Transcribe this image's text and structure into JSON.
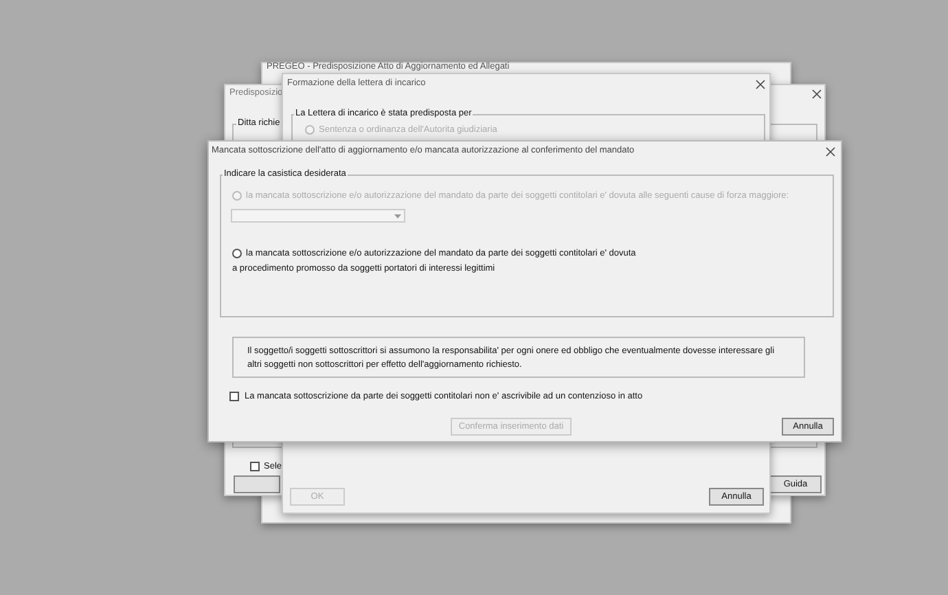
{
  "back_window": {
    "title": "PREGEO - Predisposizione Atto di Aggiornamento ed Allegati"
  },
  "middle_window": {
    "title": "Predisposizio",
    "group_title": "Ditta richie",
    "checkbox": {
      "label": "Sele",
      "checked": false
    },
    "help_button": "Guida"
  },
  "letter_window": {
    "title": "Formazione della lettera di incarico",
    "group_title": "La Lettera di incarico è stata predisposta per",
    "radio": {
      "label": "Sentenza o ordinanza dell'Autorita giudiziaria",
      "selected": false,
      "disabled": true
    },
    "ok_button": {
      "label": "OK",
      "disabled": true
    },
    "cancel_button": "Annulla"
  },
  "dialog": {
    "title": "Mancata sottoscrizione dell'atto di aggiornamento e/o mancata autorizzazione al conferimento del mandato",
    "group_title": "Indicare la casistica desiderata",
    "options": [
      {
        "kind": "radio_dropdown",
        "label": "la mancata sottoscrizione e/o autorizzazione del mandato da parte dei soggetti contitolari e' dovuta alle seguenti cause di forza maggiore:",
        "selected": false,
        "disabled": true
      },
      {
        "kind": "radio",
        "label": "la mancata sottoscrizione e/o autorizzazione del mandato da parte dei soggetti contitolari e' dovuta",
        "label_line_2": "a procedimento promosso da soggetti portatori di interessi legittimi",
        "selected": false,
        "disabled": false
      }
    ],
    "notice": "Il soggetto/i soggetti sottoscrittori si assumono la responsabilita' per ogni onere ed obbligo che eventualmente dovesse interessare gli altri soggetti non sottoscrittori per effetto dell'aggiornamento richiesto.",
    "checkbox": {
      "label": "La mancata sottoscrizione da parte dei soggetti contitolari non e' ascrivibile ad un contenzioso in atto",
      "checked": false
    },
    "confirm_button": {
      "label": "Conferma inserimento dati",
      "disabled": true
    },
    "cancel_button": "Annulla"
  }
}
